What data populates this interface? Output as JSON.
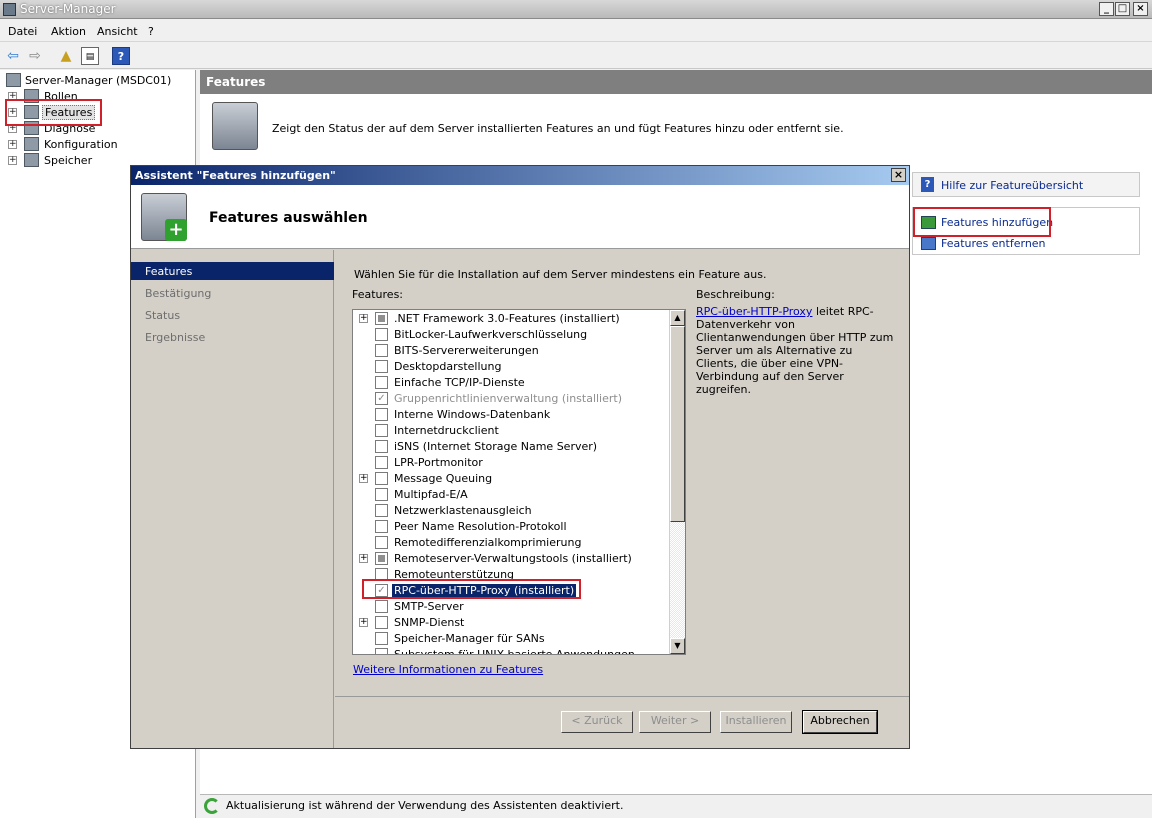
{
  "window": {
    "title": "Server-Manager",
    "minimize": "_",
    "maximize": "□",
    "close": "×"
  },
  "menu": [
    "Datei",
    "Aktion",
    "Ansicht",
    "?"
  ],
  "tree": {
    "root": "Server-Manager (MSDC01)",
    "items": [
      {
        "label": "Rollen",
        "expander": "+"
      },
      {
        "label": "Features",
        "expander": "+"
      },
      {
        "label": "Diagnose",
        "expander": "+"
      },
      {
        "label": "Konfiguration",
        "expander": "+"
      },
      {
        "label": "Speicher",
        "expander": "+"
      }
    ]
  },
  "content": {
    "header": "Features",
    "description": "Zeigt den Status der auf dem Server installierten Features an und fügt Features hinzu oder entfernt sie."
  },
  "actions": {
    "help": "Hilfe zur Featureübersicht",
    "add": "Features hinzufügen",
    "remove": "Features entfernen"
  },
  "status": {
    "text": "Aktualisierung ist während der Verwendung des Assistenten deaktiviert."
  },
  "dialog": {
    "title": "Assistent \"Features hinzufügen\"",
    "close": "×",
    "header_title": "Features auswählen",
    "nav": [
      "Features",
      "Bestätigung",
      "Status",
      "Ergebnisse"
    ],
    "instruction": "Wählen Sie für die Installation auf dem Server mindestens ein Feature aus.",
    "features_label": "Features:",
    "description_label": "Beschreibung:",
    "description_link": "RPC-über-HTTP-Proxy",
    "description_text": " leitet RPC-Datenverkehr von Clientanwendungen über HTTP zum Server um als Alternative zu Clients, die über eine VPN-Verbindung auf den Server zugreifen.",
    "more_info_link": "Weitere Informationen zu Features",
    "features": [
      {
        "label": ".NET Framework 3.0-Features (installiert)",
        "state": "partial",
        "expander": "+"
      },
      {
        "label": "BitLocker-Laufwerkverschlüsselung",
        "state": "unchecked",
        "expander": ""
      },
      {
        "label": "BITS-Servererweiterungen",
        "state": "unchecked",
        "expander": ""
      },
      {
        "label": "Desktopdarstellung",
        "state": "unchecked",
        "expander": ""
      },
      {
        "label": "Einfache TCP/IP-Dienste",
        "state": "unchecked",
        "expander": ""
      },
      {
        "label": "Gruppenrichtlinienverwaltung (installiert)",
        "state": "checked-disabled",
        "expander": ""
      },
      {
        "label": "Interne Windows-Datenbank",
        "state": "unchecked",
        "expander": ""
      },
      {
        "label": "Internetdruckclient",
        "state": "unchecked",
        "expander": ""
      },
      {
        "label": "iSNS (Internet Storage Name Server)",
        "state": "unchecked",
        "expander": ""
      },
      {
        "label": "LPR-Portmonitor",
        "state": "unchecked",
        "expander": ""
      },
      {
        "label": "Message Queuing",
        "state": "unchecked",
        "expander": "+"
      },
      {
        "label": "Multipfad-E/A",
        "state": "unchecked",
        "expander": ""
      },
      {
        "label": "Netzwerklastenausgleich",
        "state": "unchecked",
        "expander": ""
      },
      {
        "label": "Peer Name Resolution-Protokoll",
        "state": "unchecked",
        "expander": ""
      },
      {
        "label": "Remotedifferenzialkomprimierung",
        "state": "unchecked",
        "expander": ""
      },
      {
        "label": "Remoteserver-Verwaltungstools (installiert)",
        "state": "partial",
        "expander": "+"
      },
      {
        "label": "Remoteunterstützung",
        "state": "unchecked",
        "expander": ""
      },
      {
        "label": "RPC-über-HTTP-Proxy (installiert)",
        "state": "checked-selected",
        "expander": ""
      },
      {
        "label": "SMTP-Server",
        "state": "unchecked",
        "expander": ""
      },
      {
        "label": "SNMP-Dienst",
        "state": "unchecked",
        "expander": "+"
      },
      {
        "label": "Speicher-Manager für SANs",
        "state": "unchecked",
        "expander": ""
      },
      {
        "label": "Subsystem für UNIX-basierte Anwendungen",
        "state": "unchecked",
        "expander": ""
      }
    ],
    "buttons": {
      "back": "< Zurück",
      "next": "Weiter >",
      "install": "Installieren",
      "cancel": "Abbrechen"
    }
  }
}
